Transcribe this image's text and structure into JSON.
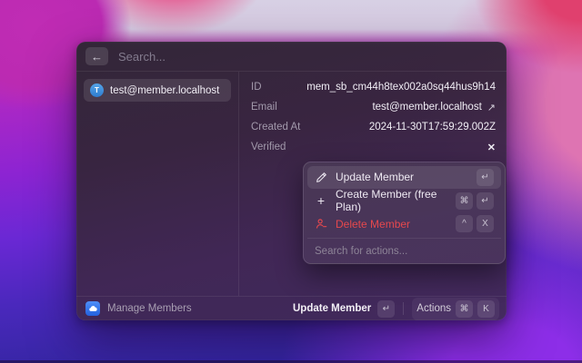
{
  "colors": {
    "danger_red": "#e5484d",
    "avatar_blue": "#3d8edb",
    "app_icon_blue": "#2f6be0",
    "selection_highlight": "rgba(255,255,255,0.10)"
  },
  "header": {
    "back_icon": "←",
    "search_placeholder": "Search..."
  },
  "member_list": {
    "items": [
      {
        "avatar_letter": "T",
        "label": "test@member.localhost",
        "selected": true
      }
    ]
  },
  "details": {
    "rows": [
      {
        "label": "ID",
        "value": "mem_sb_cm44h8tex002a0sq44hus9h14"
      },
      {
        "label": "Email",
        "value": "test@member.localhost",
        "icon": "external-link",
        "icon_glyph": "↗"
      },
      {
        "label": "Created At",
        "value": "2024-11-30T17:59:29.002Z"
      },
      {
        "label": "Verified",
        "value": "✕",
        "icon": "x-mark"
      }
    ]
  },
  "actions_menu": {
    "items": [
      {
        "label": "Update Member",
        "icon": "pencil",
        "keys": [
          "↵"
        ],
        "highlighted": true
      },
      {
        "label": "Create Member (free Plan)",
        "icon": "plus",
        "icon_glyph": "+",
        "keys": [
          "⌘",
          "↵"
        ]
      },
      {
        "label": "Delete Member",
        "icon": "member-remove",
        "keys": [
          "^",
          "X"
        ],
        "danger": true
      }
    ],
    "search_placeholder": "Search for actions..."
  },
  "footer": {
    "app_name": "Manage Members",
    "primary_label": "Update Member",
    "primary_key": "↵",
    "actions_label": "Actions",
    "actions_keys": [
      "⌘",
      "K"
    ]
  }
}
